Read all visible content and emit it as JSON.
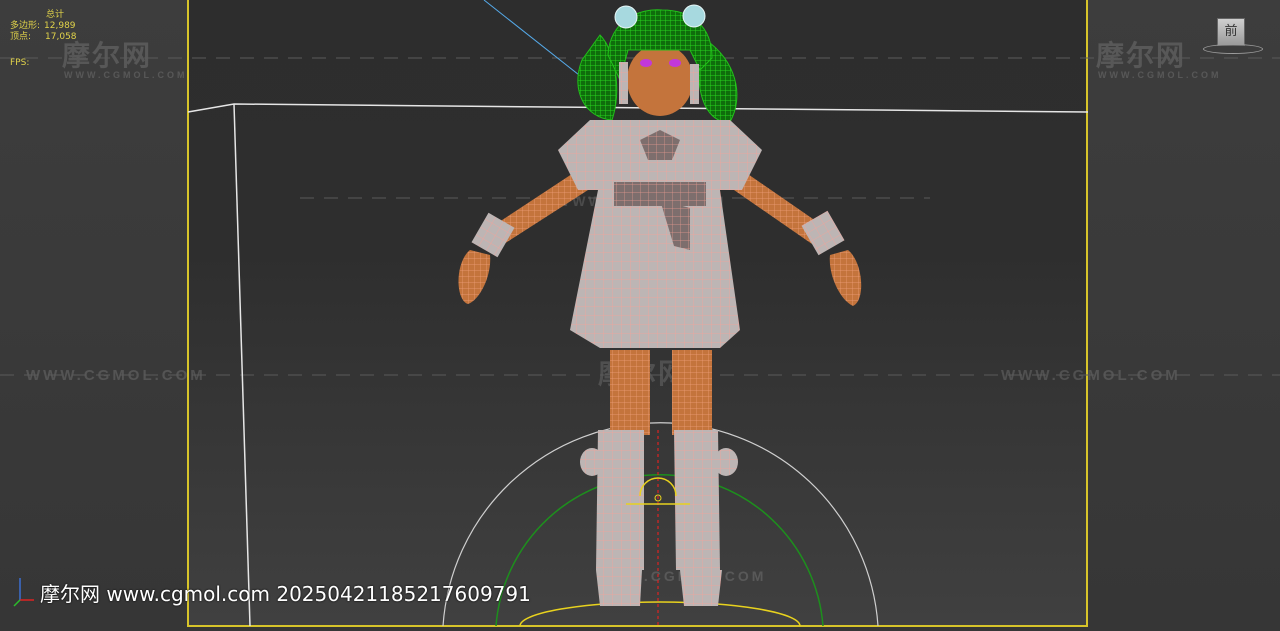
{
  "stats": {
    "title": "总计",
    "polys_label": "多边形:",
    "polys_value": "12,989",
    "verts_label": "顶点:",
    "verts_value": "17,058",
    "fps_label": "FPS:"
  },
  "viewcube": {
    "face_label": "前"
  },
  "watermarks": {
    "logo": "摩尔网",
    "sub": "WWW.CGMOL.COM",
    "domain": "WWW.CGMOL.COM"
  },
  "footer": {
    "text": "摩尔网 www.cgmol.com 20250421185217609791"
  },
  "colors": {
    "frame": "#d7c42a",
    "stats_text": "#e1d34a",
    "hair_wire": "#22c01a",
    "skin": "#c4743c",
    "cloth_wire": "#f2a39a",
    "cloth": "#b8b0b0",
    "gizmo_green": "#1d8f1d",
    "gizmo_yellow": "#e8d21e",
    "gizmo_red": "#d22",
    "light_line": "#55a9e8"
  }
}
